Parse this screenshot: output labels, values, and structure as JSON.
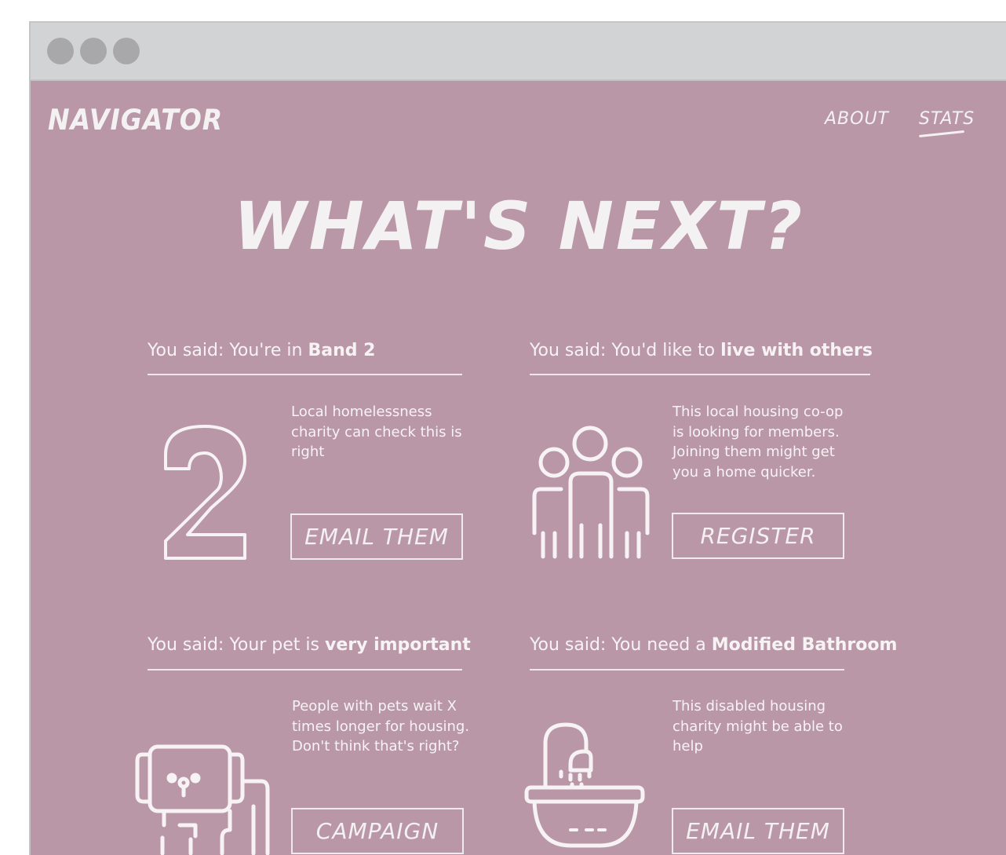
{
  "window": {
    "controls": [
      "close",
      "minimize",
      "maximize"
    ]
  },
  "header": {
    "brand": "NAVIGATOR",
    "nav": [
      {
        "label": "ABOUT"
      },
      {
        "label": "STATS",
        "active": true
      }
    ]
  },
  "hero": {
    "title": "WHAT'S NEXT?"
  },
  "cards": [
    {
      "prefix": "You said: You're in ",
      "highlight": "Band 2",
      "description": "Local homelessness charity can check this is right",
      "button": "EMAIL THEM",
      "icon": "number-two-icon"
    },
    {
      "prefix": "You said: You'd like to ",
      "highlight": "live with others",
      "description": "This local housing co-op is looking for members. Joining them might get you a home quicker.",
      "button": "REGISTER",
      "icon": "people-group-icon"
    },
    {
      "prefix": "You said: Your pet is ",
      "highlight": "very important",
      "description": "People with pets wait X times longer for housing. Don't think that's right?",
      "button": "CAMPAIGN",
      "icon": "dog-icon"
    },
    {
      "prefix": "You said: You need a ",
      "highlight": "Modified Bathroom",
      "description": "This disabled housing charity might be able to help",
      "button": "EMAIL THEM",
      "icon": "bathtub-shower-icon"
    }
  ],
  "colors": {
    "page_background": "#ba97a6",
    "titlebar": "#d2d3d5",
    "text": "#f4f1f2"
  }
}
